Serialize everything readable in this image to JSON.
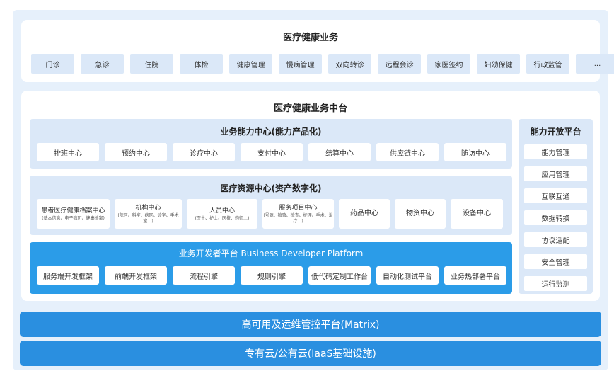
{
  "business": {
    "title": "医疗健康业务",
    "items": [
      "门诊",
      "急诊",
      "住院",
      "体检",
      "健康管理",
      "慢病管理",
      "双向转诊",
      "远程会诊",
      "家医签约",
      "妇幼保健",
      "行政监管",
      "..."
    ]
  },
  "middle": {
    "title": "医疗健康业务中台",
    "capability": {
      "title": "业务能力中心(能力产品化)",
      "items": [
        "排班中心",
        "预约中心",
        "诊疗中心",
        "支付中心",
        "结算中心",
        "供应链中心",
        "随访中心"
      ]
    },
    "resource": {
      "title": "医疗资源中心(资产数字化)",
      "items": [
        {
          "name": "患者医疗健康档案中心",
          "sub": "(基本信息、电子病历、健康档案)"
        },
        {
          "name": "机构中心",
          "sub": "(院区、科室、病区、诊室、手术室…)"
        },
        {
          "name": "人员中心",
          "sub": "(医生、护士、医技、药师…)"
        },
        {
          "name": "服务项目中心",
          "sub": "(号源、检验、检查、护理、手术、治疗…)"
        },
        {
          "name": "药品中心",
          "sub": ""
        },
        {
          "name": "物资中心",
          "sub": ""
        },
        {
          "name": "设备中心",
          "sub": ""
        }
      ]
    },
    "developer": {
      "title": "业务开发者平台 Business Developer Platform",
      "items": [
        "服务端开发框架",
        "前端开发框架",
        "流程引擎",
        "规则引擎",
        "低代码定制工作台",
        "自动化测试平台",
        "业务热部署平台"
      ]
    },
    "open_platform": {
      "title": "能力开放平台",
      "items": [
        "能力管理",
        "应用管理",
        "互联互通",
        "数据转换",
        "协议适配",
        "安全管理",
        "运行监测"
      ]
    }
  },
  "bottom": {
    "matrix": "高可用及运维管控平台(Matrix)",
    "iaas": "专有云/公有云(IaaS基础设施)"
  },
  "colors": {
    "panel_bg": "#e6f0fb",
    "chip_bg": "#dbe8f8",
    "dev_blue": "#2b9ce8",
    "bar_blue": "#2a8fe0"
  }
}
